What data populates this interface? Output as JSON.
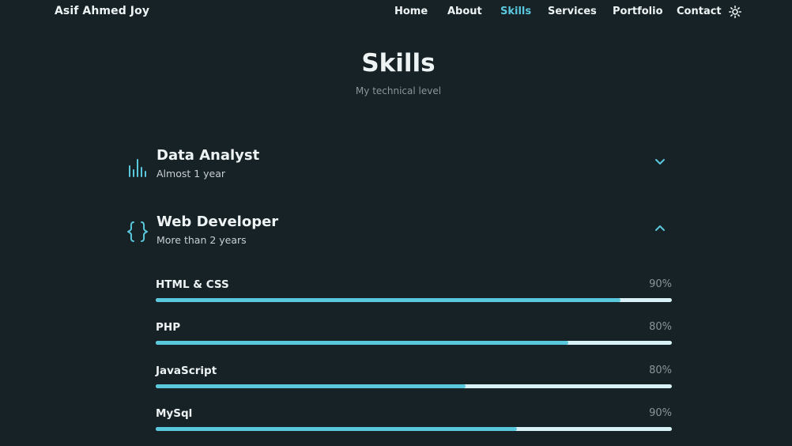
{
  "header": {
    "logo": "Asif Ahmed Joy",
    "nav": [
      {
        "label": "Home",
        "active": false
      },
      {
        "label": "About",
        "active": false
      },
      {
        "label": "Skills",
        "active": true
      },
      {
        "label": "Services",
        "active": false
      },
      {
        "label": "Portfolio",
        "active": false
      },
      {
        "label": "Contact",
        "active": false
      }
    ],
    "theme_icon": "sun-icon"
  },
  "section": {
    "title": "Skills",
    "subtitle": "My technical level"
  },
  "groups": [
    {
      "title": "Data Analyst",
      "subtitle": "Almost 1 year",
      "icon": "bar-chart-icon",
      "expanded": false
    },
    {
      "title": "Web Developer",
      "subtitle": "More than 2 years",
      "icon": "braces-icon",
      "expanded": true,
      "skills": [
        {
          "name": "HTML & CSS",
          "percent_label": "90%",
          "fill": 0.9
        },
        {
          "name": "PHP",
          "percent_label": "80%",
          "fill": 0.8
        },
        {
          "name": "JavaScript",
          "percent_label": "80%",
          "fill": 0.6
        },
        {
          "name": "MySql",
          "percent_label": "90%",
          "fill": 0.7
        }
      ]
    }
  ],
  "colors": {
    "background": "#172227",
    "accent": "#5ac8dc",
    "track": "#d7f1f6",
    "text": "#eef3f4",
    "muted": "#8a9599"
  }
}
